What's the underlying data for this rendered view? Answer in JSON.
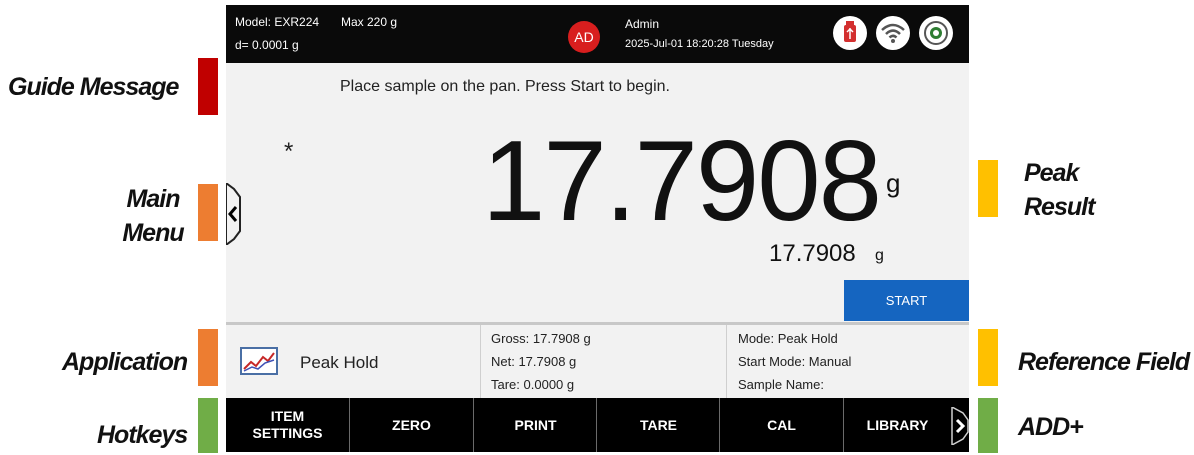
{
  "status_bar": {
    "model": "Model: EXR224",
    "max": "Max 220 g",
    "readability": "d= 0.0001 g",
    "user_initials": "AD",
    "user_name": "Admin",
    "datetime": "2025-Jul-01 18:20:28 Tuesday",
    "icons": [
      "usb-icon",
      "wifi-icon",
      "level-icon"
    ]
  },
  "guide_message": "Place sample on the pan.  Press Start to begin.",
  "stability_mark": "*",
  "main_reading": {
    "value": "17.7908",
    "unit": "g"
  },
  "peak_result": {
    "value": "17.7908",
    "unit": "g"
  },
  "start_button": "START",
  "application": {
    "icon": "chart-line-icon",
    "name": "Peak Hold"
  },
  "weights": {
    "gross": "Gross: 17.7908 g",
    "net": "Net: 17.7908 g",
    "tare": "Tare: 0.0000 g"
  },
  "reference": {
    "mode": "Mode: Peak Hold",
    "start_mode": "Start Mode: Manual",
    "sample_name": "Sample Name:"
  },
  "hotkeys": [
    {
      "label": "ITEM\nSETTINGS"
    },
    {
      "label": "ZERO"
    },
    {
      "label": "PRINT"
    },
    {
      "label": "TARE"
    },
    {
      "label": "CAL"
    },
    {
      "label": "LIBRARY"
    }
  ],
  "annotations": {
    "guide_message": "Guide Message",
    "main_menu_1": "Main",
    "main_menu_2": "Menu",
    "application": "Application",
    "hotkeys": "Hotkeys",
    "peak_result_1": "Peak",
    "peak_result_2": "Result",
    "reference_field": "Reference Field",
    "add": "ADD+"
  },
  "colors": {
    "red_marker": "#c00000",
    "orange_marker": "#ed7d31",
    "yellow_marker": "#ffc000",
    "green_marker": "#70ad47",
    "start_button": "#1565c0",
    "avatar": "#d81e1e"
  }
}
